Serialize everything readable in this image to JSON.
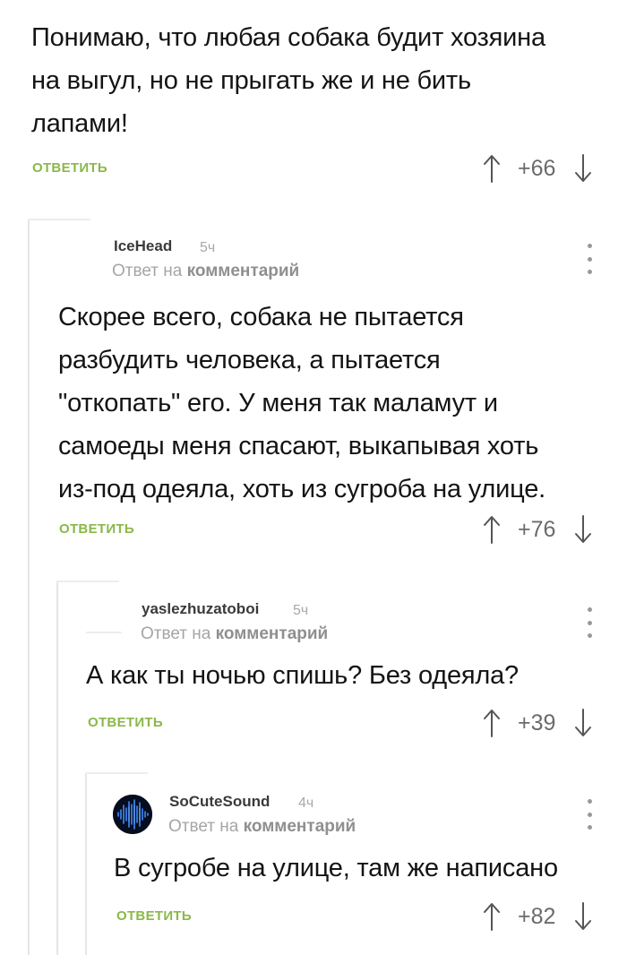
{
  "comments": [
    {
      "text": "Понимаю, что любая собака будит хозяина\nна выгул, но не прыгать же и не бить\nлапами!",
      "reply_label": "ОТВЕТИТЬ",
      "rating": "+66"
    },
    {
      "author": "IceHead",
      "time": "5ч",
      "reply_prefix": "Ответ на",
      "reply_target": "комментарий",
      "text": "Скорее всего, собака не пытается\nразбудить человека, а пытается\n\"откопать\" его. У меня так маламут и\nсамоеды меня спасают, выкапывая хоть\nиз-под одеяла, хоть из сугроба на улице.",
      "reply_label": "ОТВЕТИТЬ",
      "rating": "+76"
    },
    {
      "author": "yaslezhuzatoboi",
      "time": "5ч",
      "reply_prefix": "Ответ на",
      "reply_target": "комментарий",
      "text": "А как ты ночью спишь? Без одеяла?",
      "reply_label": "ОТВЕТИТЬ",
      "rating": "+39"
    },
    {
      "author": "SoCuteSound",
      "time": "4ч",
      "reply_prefix": "Ответ на",
      "reply_target": "комментарий",
      "text": "В сугробе на улице, там же написано",
      "reply_label": "ОТВЕТИТЬ",
      "rating": "+82"
    }
  ],
  "icons": {
    "upvote": "arrow-up-icon",
    "downvote": "arrow-down-icon",
    "more": "more-vertical-icon",
    "avatar": "soundwave-avatar"
  },
  "colors": {
    "reply_link": "#8ab848",
    "rating": "#6b6b6b",
    "thread_line": "#e6e6e6"
  }
}
